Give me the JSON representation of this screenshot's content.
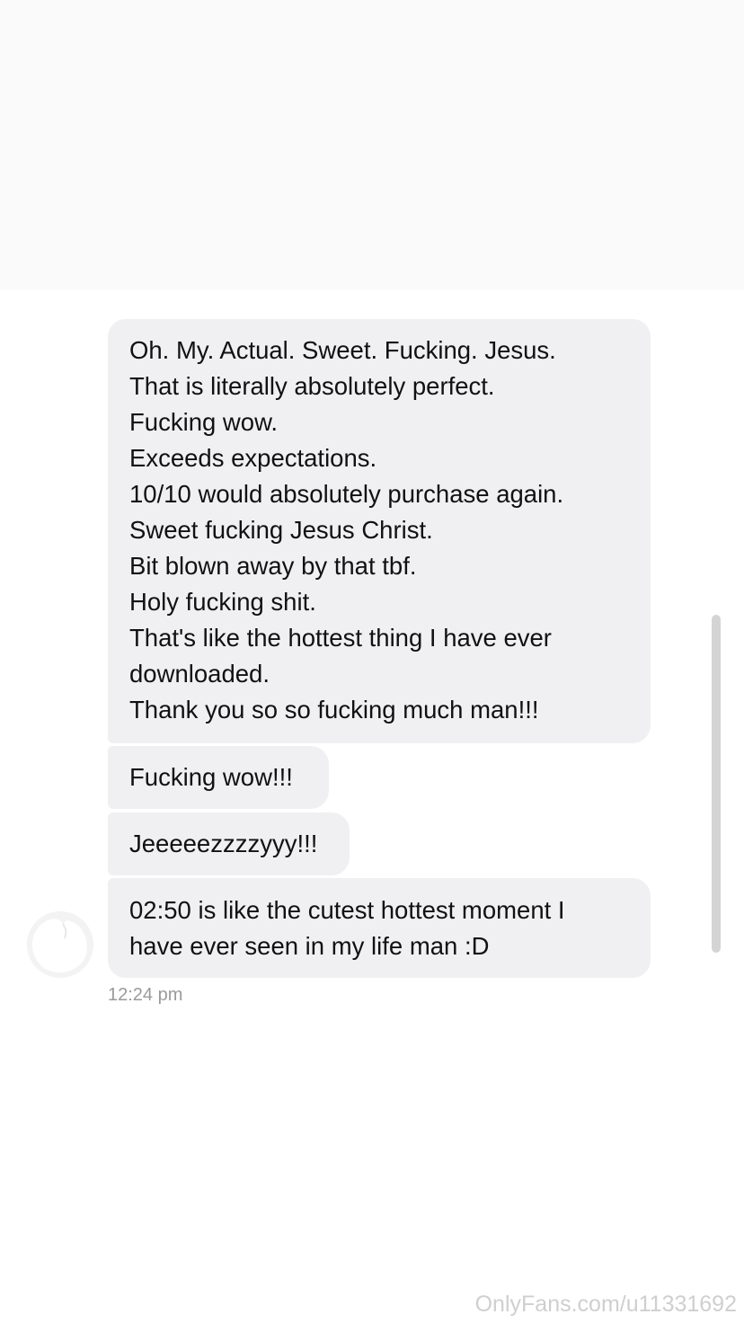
{
  "conversation": {
    "messages": [
      {
        "lines": [
          "Oh. My. Actual. Sweet. Fucking. Jesus.",
          "That is literally absolutely perfect.",
          "Fucking wow.",
          "Exceeds expectations.",
          "10/10 would absolutely purchase again.",
          "Sweet fucking Jesus Christ.",
          "Bit blown away by that tbf.",
          "Holy fucking shit.",
          "That's like the hottest thing I have ever",
          "downloaded.",
          "Thank you so so fucking much man!!!"
        ]
      },
      {
        "lines": [
          "Fucking wow!!!"
        ]
      },
      {
        "lines": [
          "Jeeeeezzzzyyy!!!"
        ]
      },
      {
        "lines": [
          "02:50 is like the cutest hottest moment I",
          "have ever seen in my life man :D"
        ]
      }
    ],
    "timestamp": "12:24 pm"
  },
  "watermark": "OnlyFans.com/u11331692",
  "colors": {
    "bubble": "#f0f0f2",
    "text": "#111111",
    "timestamp": "#9a9a9a",
    "scrollbar": "#d4d4d4",
    "top_band": "#fafafa"
  },
  "icons": {
    "avatar": "avatar-icon"
  }
}
